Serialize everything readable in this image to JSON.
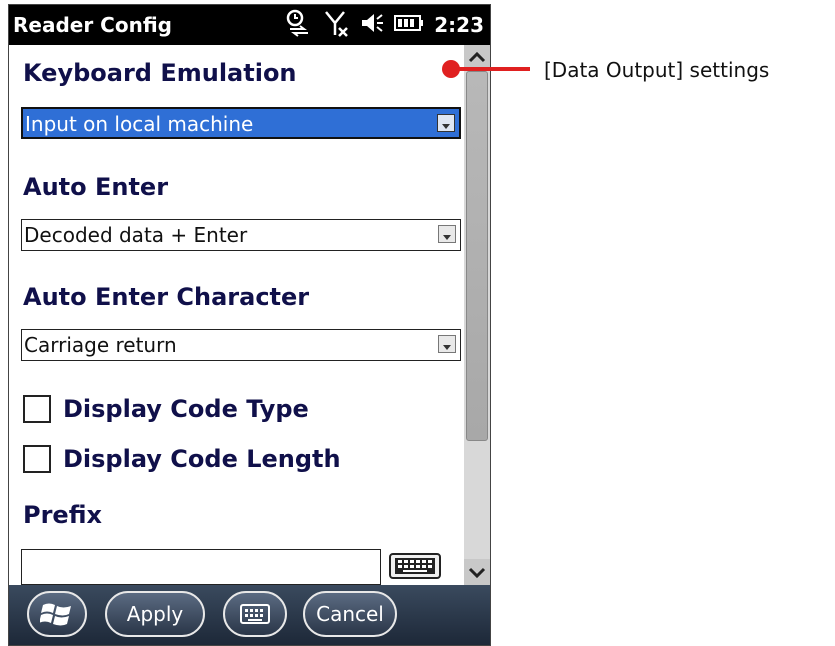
{
  "window": {
    "title": "Reader Config",
    "clock": "2:23"
  },
  "status_icons": [
    "sync-icon",
    "no-signal-icon",
    "speaker-icon",
    "battery-icon"
  ],
  "sections": {
    "keyboard_emulation": {
      "heading": "Keyboard Emulation",
      "value": "Input on local machine"
    },
    "auto_enter": {
      "heading": "Auto Enter",
      "value": "Decoded data + Enter"
    },
    "auto_enter_character": {
      "heading": "Auto Enter Character",
      "value": "Carriage return"
    },
    "display_code_type": {
      "label": "Display Code Type",
      "checked": false
    },
    "display_code_length": {
      "label": "Display Code Length",
      "checked": false
    },
    "prefix": {
      "heading": "Prefix",
      "value": ""
    }
  },
  "softkeys": {
    "apply": "Apply",
    "cancel": "Cancel"
  },
  "callout": {
    "text": "[Data Output] settings"
  },
  "colors": {
    "focus_blue": "#2f6fd6",
    "heading": "#10104a",
    "callout_red": "#e02020"
  }
}
